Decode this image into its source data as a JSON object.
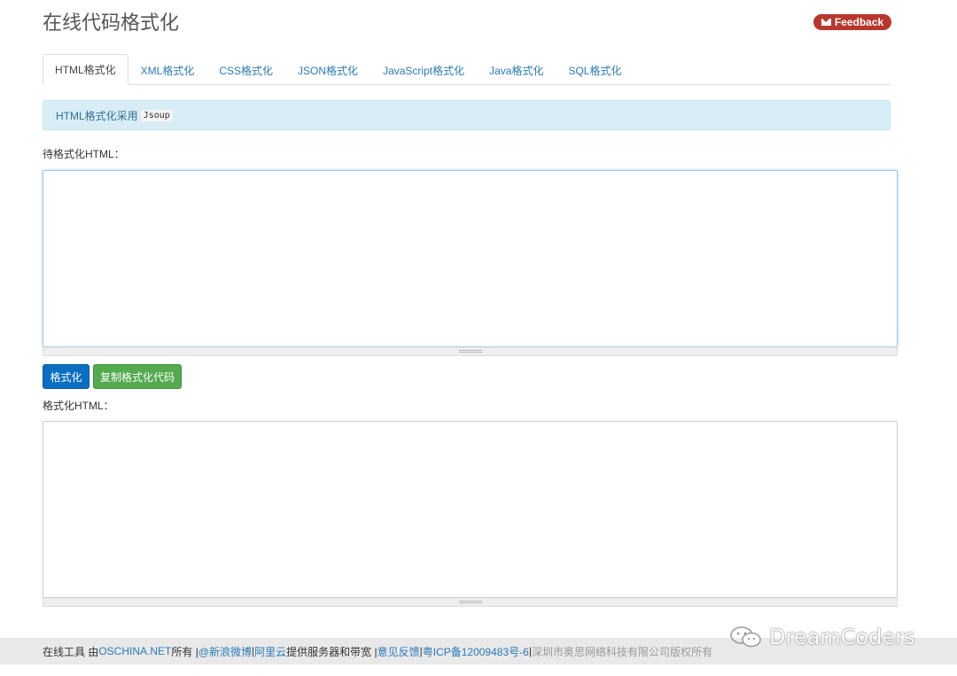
{
  "page_title": "在线代码格式化",
  "feedback_label": "Feedback",
  "tabs": [
    {
      "label": "HTML格式化",
      "active": true
    },
    {
      "label": "XML格式化"
    },
    {
      "label": "CSS格式化"
    },
    {
      "label": "JSON格式化"
    },
    {
      "label": "JavaScript格式化"
    },
    {
      "label": "Java格式化"
    },
    {
      "label": "SQL格式化"
    }
  ],
  "info": {
    "text": "HTML格式化采用",
    "code": "Jsoup"
  },
  "input": {
    "label": "待格式化HTML：",
    "value": ""
  },
  "buttons": {
    "format": "格式化",
    "copy": "复制格式化代码"
  },
  "output": {
    "label": "格式化HTML：",
    "value": ""
  },
  "footer": {
    "prefix": "在线工具 由 ",
    "oschina": "OSCHINA.NET",
    "owns": " 所有 | ",
    "weibo": "@新浪微博",
    "sep1": " |",
    "aliyun": "阿里云",
    "provides": "提供服务器和带宽 |",
    "feedback": "意见反馈",
    "sep2": " | ",
    "icp": "粤ICP备12009483号-6",
    "sep3": " | ",
    "copyright": "深圳市奥思网络科技有限公司版权所有"
  },
  "watermark": "DreamCoders",
  "colors": {
    "accent": "#2a7ab8",
    "feedback": "#b7372e",
    "primary": "#0a6fc2",
    "success": "#53aa4f",
    "info_bg": "#d9edf7"
  }
}
